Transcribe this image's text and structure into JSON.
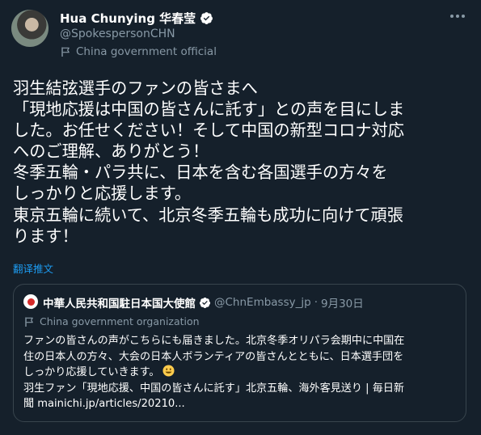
{
  "author": {
    "name": "Hua Chunying 华春莹",
    "handle": "@SpokespersonCHN",
    "label": "China government official",
    "colors": {
      "verified": "#1d9bf0",
      "muted": "#8899a6"
    }
  },
  "tweet": {
    "lines": [
      "羽生結弦選手のファンの皆さまへ",
      "「現地応援は中国の皆さんに託す」との声を目にしま",
      "した。お任せください！そして中国の新型コロナ対応",
      "へのご理解、ありがとう！",
      "冬季五輪・パラ共に、日本を含む各国選手の方々を",
      "しっかりと応援します。",
      "東京五輪に続いて、北京冬季五輪も成功に向けて頑張",
      "ります！"
    ],
    "translate_link": "翻译推文"
  },
  "quote": {
    "name": "中華人民共和国駐日本国大使館",
    "handle": "@ChnEmbassy_jp",
    "separator": "·",
    "date": "9月30日",
    "label": "China government organization",
    "lines": [
      "ファンの皆さんの声がこちらにも届きました。北京冬季オリパラ会期中に中国在",
      "住の日本人の方々、大会の日本人ボランティアの皆さんとともに、日本選手団を",
      "しっかり応援していきます。",
      "羽生ファン「現地応援、中国の皆さんに託す」北京五輪、海外客見送り | 毎日新",
      "聞 mainichi.jp/articles/20210..."
    ],
    "emoji": "grinning-face"
  },
  "theme": {
    "background": "#15202b",
    "border": "#38444d",
    "link": "#1d9bf0"
  }
}
